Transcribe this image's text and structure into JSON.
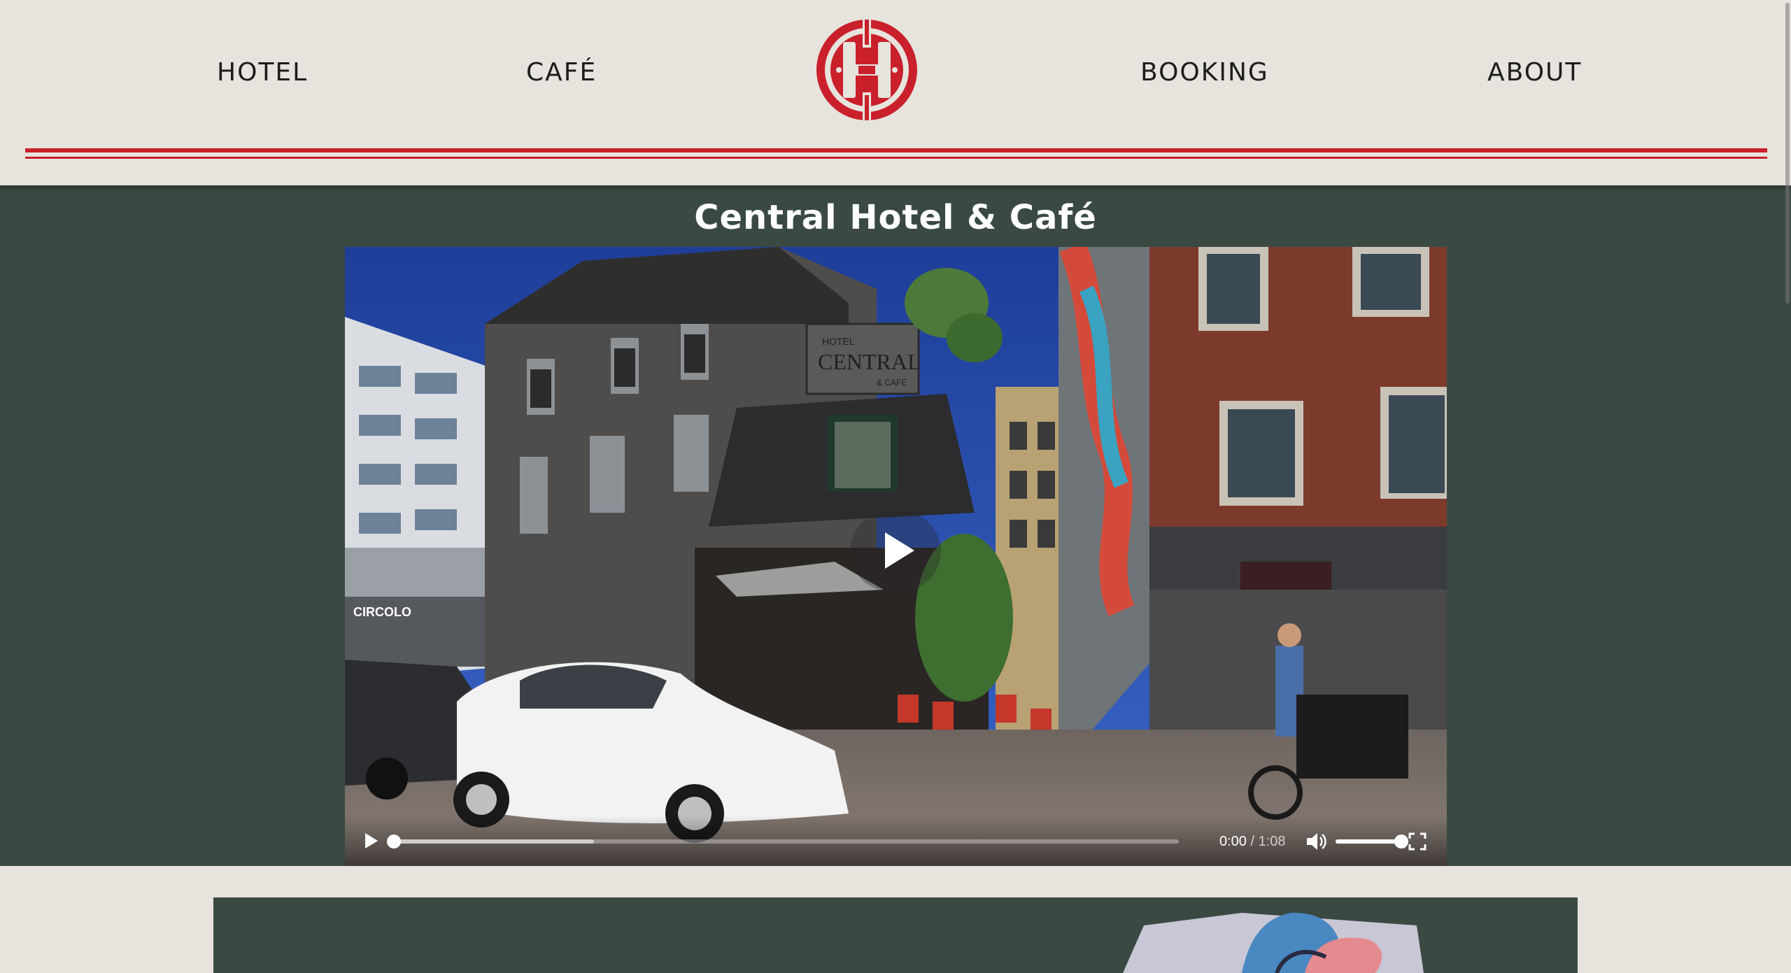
{
  "nav": {
    "items": [
      {
        "label": "HOTEL"
      },
      {
        "label": "CAFÉ"
      },
      {
        "label": "BOOKING"
      },
      {
        "label": "ABOUT"
      }
    ],
    "logo_letter": "H"
  },
  "hero": {
    "title": "Central Hotel & Café",
    "video": {
      "sign_top": "HOTEL",
      "sign_main": "CENTRAL",
      "sign_bottom": "& CAFÉ",
      "store_sign": "CIRCOLO",
      "current_time": "0:00",
      "separator": "/",
      "duration": "1:08",
      "progress_fraction": 0,
      "buffered_fraction": 0.26,
      "volume_fraction": 1.0
    }
  },
  "icons": {
    "big_play": "play-icon",
    "play": "play-icon",
    "mute": "speaker-icon",
    "fullscreen": "fullscreen-icon",
    "logo": "hotel-logo"
  },
  "colors": {
    "accent_red": "#c9202b",
    "header_bg": "#e7e3dd",
    "hero_bg": "#3a4a43",
    "text_dark": "#1d1d1d"
  }
}
